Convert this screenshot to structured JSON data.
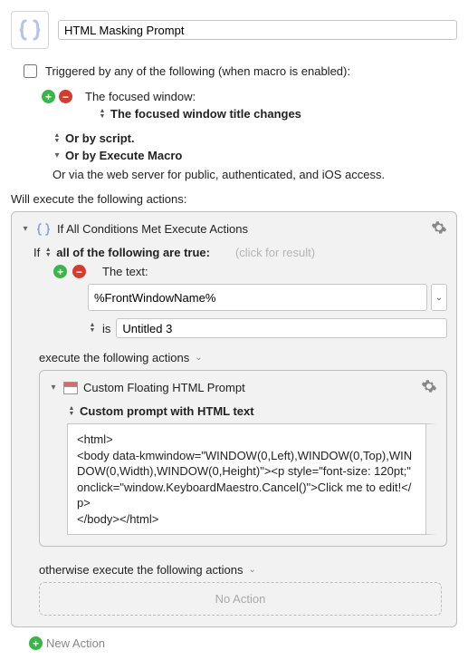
{
  "header": {
    "macro_name": "HTML Masking Prompt"
  },
  "trigger": {
    "checkbox_label": "Triggered by any of the following (when macro is enabled):",
    "focused_window": "The focused window:",
    "title_changes": "The focused window title changes",
    "or_script": "Or by script.",
    "or_execute_macro": "Or by Execute Macro",
    "or_via_web": "Or via the web server for public, authenticated, and iOS access."
  },
  "actions_header": "Will execute the following actions:",
  "if_action": {
    "title": "If All Conditions Met Execute Actions",
    "if_label": "If",
    "all_true": "all of the following are true:",
    "hint": "(click for result)",
    "the_text": "The text:",
    "var_value": "%FrontWindowName%",
    "is_label": "is",
    "is_value": "Untitled 3",
    "execute_label": "execute the following actions",
    "otherwise_label": "otherwise execute the following actions",
    "no_action": "No Action"
  },
  "html_prompt": {
    "title": "Custom Floating HTML Prompt",
    "subtitle": "Custom prompt with HTML text",
    "content": "<html>\n<body data-kmwindow=\"WINDOW(0,Left),WINDOW(0,Top),WINDOW(0,Width),WINDOW(0,Height)\"><p style=\"font-size: 120pt;\" onclick=\"window.KeyboardMaestro.Cancel()\">Click me to edit!</p>\n</body></html>"
  },
  "footer": {
    "new_action": "New Action"
  }
}
